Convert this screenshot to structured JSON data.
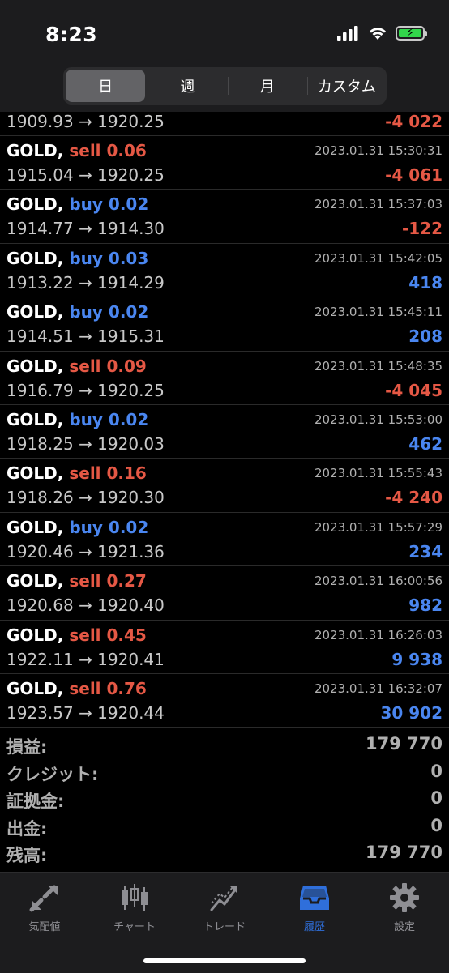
{
  "status": {
    "time": "8:23"
  },
  "segments": [
    {
      "label": "日",
      "active": true
    },
    {
      "label": "週",
      "active": false
    },
    {
      "label": "月",
      "active": false
    },
    {
      "label": "カスタム",
      "active": false
    }
  ],
  "partial_row": {
    "prices": "1909.93 → 1920.25",
    "pnl": "-4 022"
  },
  "trades": [
    {
      "symbol": "GOLD,",
      "side": "sell",
      "volume": "sell 0.06",
      "datetime": "2023.01.31 15:30:31",
      "prices": "1915.04 → 1920.25",
      "pnl": "-4 061"
    },
    {
      "symbol": "GOLD,",
      "side": "buy",
      "volume": "buy 0.02",
      "datetime": "2023.01.31 15:37:03",
      "prices": "1914.77 → 1914.30",
      "pnl": "-122"
    },
    {
      "symbol": "GOLD,",
      "side": "buy",
      "volume": "buy 0.03",
      "datetime": "2023.01.31 15:42:05",
      "prices": "1913.22 → 1914.29",
      "pnl": "418"
    },
    {
      "symbol": "GOLD,",
      "side": "buy",
      "volume": "buy 0.02",
      "datetime": "2023.01.31 15:45:11",
      "prices": "1914.51 → 1915.31",
      "pnl": "208"
    },
    {
      "symbol": "GOLD,",
      "side": "sell",
      "volume": "sell 0.09",
      "datetime": "2023.01.31 15:48:35",
      "prices": "1916.79 → 1920.25",
      "pnl": "-4 045"
    },
    {
      "symbol": "GOLD,",
      "side": "buy",
      "volume": "buy 0.02",
      "datetime": "2023.01.31 15:53:00",
      "prices": "1918.25 → 1920.03",
      "pnl": "462"
    },
    {
      "symbol": "GOLD,",
      "side": "sell",
      "volume": "sell 0.16",
      "datetime": "2023.01.31 15:55:43",
      "prices": "1918.26 → 1920.30",
      "pnl": "-4 240"
    },
    {
      "symbol": "GOLD,",
      "side": "buy",
      "volume": "buy 0.02",
      "datetime": "2023.01.31 15:57:29",
      "prices": "1920.46 → 1921.36",
      "pnl": "234"
    },
    {
      "symbol": "GOLD,",
      "side": "sell",
      "volume": "sell 0.27",
      "datetime": "2023.01.31 16:00:56",
      "prices": "1920.68 → 1920.40",
      "pnl": "982"
    },
    {
      "symbol": "GOLD,",
      "side": "sell",
      "volume": "sell 0.45",
      "datetime": "2023.01.31 16:26:03",
      "prices": "1922.11 → 1920.41",
      "pnl": "9 938"
    },
    {
      "symbol": "GOLD,",
      "side": "sell",
      "volume": "sell 0.76",
      "datetime": "2023.01.31 16:32:07",
      "prices": "1923.57 → 1920.44",
      "pnl": "30 902"
    }
  ],
  "summary": [
    {
      "label": "損益:",
      "value": "179 770"
    },
    {
      "label": "クレジット:",
      "value": "0"
    },
    {
      "label": "証拠金:",
      "value": "0"
    },
    {
      "label": "出金:",
      "value": "0"
    },
    {
      "label": "残高:",
      "value": "179 770"
    }
  ],
  "tabs": [
    {
      "label": "気配値",
      "icon": "quotes-icon",
      "active": false
    },
    {
      "label": "チャート",
      "icon": "chart-icon",
      "active": false
    },
    {
      "label": "トレード",
      "icon": "trade-icon",
      "active": false
    },
    {
      "label": "履歴",
      "icon": "history-icon",
      "active": true
    },
    {
      "label": "設定",
      "icon": "settings-icon",
      "active": false
    }
  ],
  "colors": {
    "sell": "#e55845",
    "buy": "#4a86f0",
    "active_tab": "#2f6fdb"
  }
}
